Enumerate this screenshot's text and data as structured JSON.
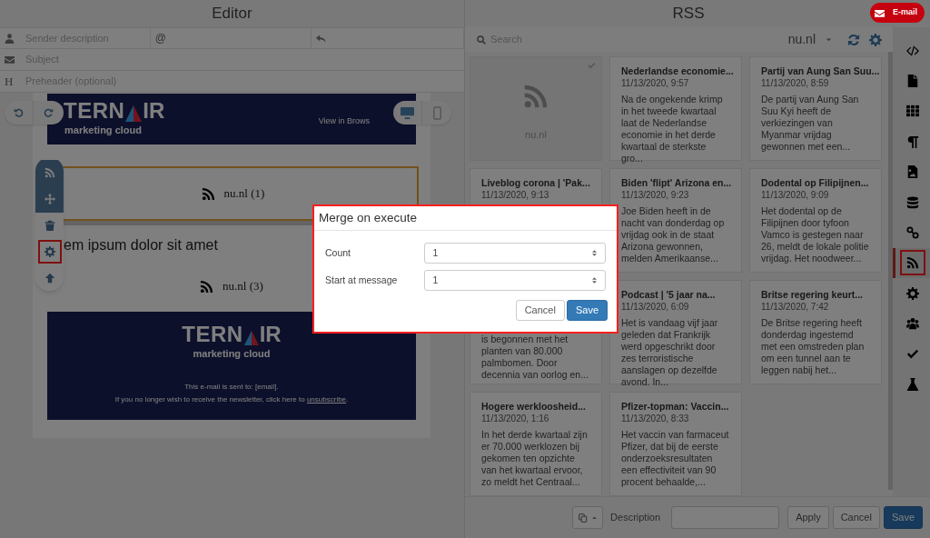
{
  "editor": {
    "title": "Editor",
    "sender_fields": [
      {
        "kind": "name",
        "placeholder": "Sender description"
      },
      {
        "kind": "address",
        "prefix": "@"
      },
      {
        "kind": "reply_to"
      }
    ],
    "subject": {
      "placeholder": "Subject"
    },
    "preheader": {
      "prefix": "H",
      "placeholder": "Preheader (optional)"
    },
    "history": [
      {
        "kind": "undo"
      },
      {
        "kind": "redo"
      }
    ],
    "devices": [
      {
        "kind": "desktop",
        "selected": true
      },
      {
        "kind": "mobile",
        "selected": false
      }
    ],
    "email": {
      "logo": {
        "before": "TERN",
        "after": "IR",
        "tagline": "marketing cloud"
      },
      "view_link": "View in Brows",
      "blocks": [
        {
          "kind": "rss",
          "label": "nu.nl (1)",
          "selected": true
        },
        {
          "kind": "text",
          "text": "em ipsum dolor sit amet"
        },
        {
          "kind": "rss",
          "label": "nu.nl (3)",
          "selected": false
        }
      ],
      "footer": {
        "logo": {
          "before": "TERN",
          "after": "IR",
          "tagline": "marketing cloud"
        },
        "line1": "This e-mail is sent to: [email].",
        "line2": "If you no longer wish to receive the newsletter, click here to",
        "link": "unsubscribe",
        "line2_end": "."
      }
    },
    "block_toolbar": [
      {
        "kind": "rss",
        "handle": true,
        "highlighted": false
      },
      {
        "kind": "move",
        "handle": true,
        "highlighted": false
      },
      {
        "kind": "delete",
        "handle": false,
        "highlighted": false
      },
      {
        "kind": "settings",
        "handle": false,
        "highlighted": true
      },
      {
        "kind": "up",
        "handle": false,
        "highlighted": false
      }
    ]
  },
  "rss": {
    "title": "RSS",
    "email_button": "E-mail",
    "search": {
      "placeholder": "Search"
    },
    "feed": "nu.nl",
    "cards": [
      {
        "kind": "source",
        "label": "nu.nl",
        "selected": true
      },
      {
        "kind": "article",
        "title": "Nederlandse economie...",
        "date": "11/13/2020, 9:57",
        "body": "Na de ongekende krimp in het tweede kwartaal laat de Nederlandse economie in het derde kwartaal de sterkste gro..."
      },
      {
        "kind": "article",
        "title": "Partij van Aung San Suu...",
        "date": "11/13/2020, 8:59",
        "body": "De partij van Aung San Suu Kyi heeft de verkiezingen van Myanmar vrijdag gewonnen met een..."
      },
      {
        "kind": "article",
        "title": "Liveblog corona | 'Pak...",
        "date": "11/13/2020, 9:13"
      },
      {
        "kind": "article",
        "title": "Biden 'flipt' Arizona en...",
        "date": "11/13/2020, 9:23",
        "body": "Joe Biden heeft in de nacht van donderdag op vrijdag ook in de staat Arizona gewonnen, melden Amerikaanse..."
      },
      {
        "kind": "article",
        "title": "Dodental op Filipijnen...",
        "date": "11/13/2020, 9:09",
        "body": "Het dodental op de Filipijnen door tyfoon Vamco is gestegen naar 26, meldt de lokale politie vrijdag. Het noodweer..."
      },
      {
        "kind": "article",
        "body": "is begonnen met het planten van 80.000 palmbomen. Door decennia van oorlog en..."
      },
      {
        "kind": "article",
        "title": "Podcast | '5 jaar na...",
        "date": "11/13/2020, 6:09",
        "body": "Het is vandaag vijf jaar geleden dat Frankrijk werd opgeschrikt door zes terroristische aanslagen op dezelfde avond. In..."
      },
      {
        "kind": "article",
        "title": "Britse regering keurt...",
        "date": "11/13/2020, 7:42",
        "body": "De Britse regering heeft donderdag ingestemd met een omstreden plan om een tunnel aan te leggen nabij het..."
      },
      {
        "kind": "article",
        "title": "Hogere werkloosheid...",
        "date": "11/13/2020, 1:16",
        "body": "In het derde kwartaal zijn er 70.000 werklozen bij gekomen ten opzichte van het kwartaal ervoor, zo meldt het Centraal..."
      },
      {
        "kind": "article",
        "title": "Pfizer-topman: Vaccin...",
        "date": "11/13/2020, 8:33",
        "body": "Het vaccin van farmaceut Pfizer, dat bij de eerste onderzoeksresultaten een effectiviteit van 90 procent behaalde,..."
      }
    ],
    "footer": {
      "description_label": "Description",
      "buttons": [
        {
          "label": "Apply",
          "kind": "default"
        },
        {
          "label": "Cancel",
          "kind": "default"
        },
        {
          "label": "Save",
          "kind": "primary"
        }
      ]
    }
  },
  "sidebar": [
    {
      "kind": "code",
      "selected": false,
      "highlighted": false
    },
    {
      "kind": "file",
      "selected": false,
      "highlighted": false
    },
    {
      "kind": "grid",
      "selected": false,
      "highlighted": false
    },
    {
      "kind": "paragraph",
      "selected": false,
      "highlighted": false
    },
    {
      "kind": "image",
      "selected": false,
      "highlighted": false
    },
    {
      "kind": "database",
      "selected": false,
      "highlighted": false
    },
    {
      "kind": "link",
      "selected": false,
      "highlighted": false
    },
    {
      "kind": "rss",
      "selected": true,
      "highlighted": true
    },
    {
      "kind": "settings",
      "selected": false,
      "highlighted": false
    },
    {
      "kind": "users",
      "selected": false,
      "highlighted": false
    },
    {
      "kind": "approve",
      "selected": false,
      "highlighted": false
    },
    {
      "kind": "flask",
      "selected": false,
      "highlighted": false
    }
  ],
  "modal": {
    "title": "Merge on execute",
    "highlighted": true,
    "fields": [
      {
        "label": "Count",
        "value": "1"
      },
      {
        "label": "Start at message",
        "value": "1"
      }
    ],
    "buttons": [
      {
        "label": "Cancel",
        "kind": "default"
      },
      {
        "label": "Save",
        "kind": "primary"
      }
    ]
  }
}
